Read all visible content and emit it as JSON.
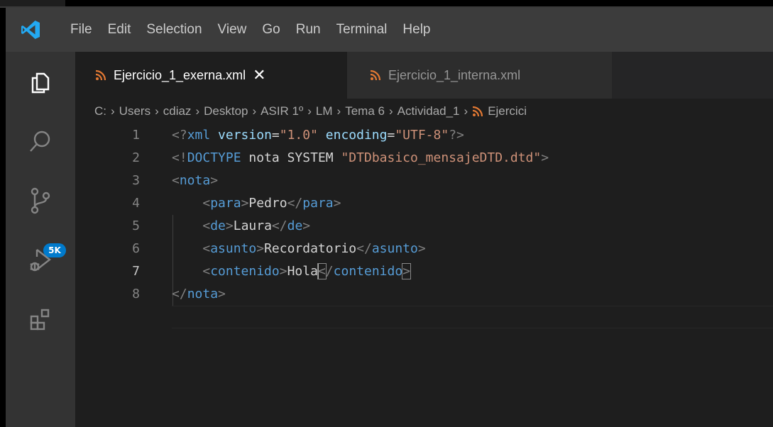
{
  "menu": {
    "items": [
      "File",
      "Edit",
      "Selection",
      "View",
      "Go",
      "Run",
      "Terminal",
      "Help"
    ]
  },
  "activity_bar": {
    "icons": [
      "files-icon",
      "search-icon",
      "source-control-icon",
      "run-debug-icon",
      "extensions-icon"
    ],
    "source_control_badge": "5K",
    "badge_color": "#007acc"
  },
  "tabs": [
    {
      "label": "Ejercicio_1_exerna.xml",
      "icon": "rss-icon",
      "active": true,
      "close_label": "✕"
    },
    {
      "label": "Ejercicio_1_interna.xml",
      "icon": "rss-icon",
      "active": false
    }
  ],
  "breadcrumb": {
    "parts": [
      "C:",
      "Users",
      "cdiaz",
      "Desktop",
      "ASIR 1º",
      "LM",
      "Tema 6",
      "Actividad_1",
      "Ejercici"
    ],
    "separator": "›"
  },
  "editor": {
    "current_line": 7,
    "lines": [
      {
        "n": "1",
        "text": "<?xml version=\"1.0\" encoding=\"UTF-8\"?>"
      },
      {
        "n": "2",
        "text": "<!DOCTYPE nota SYSTEM \"DTDbasico_mensajeDTD.dtd\">"
      },
      {
        "n": "3",
        "text": "<nota>"
      },
      {
        "n": "4",
        "text": "    <para>Pedro</para>"
      },
      {
        "n": "5",
        "text": "    <de>Laura</de>"
      },
      {
        "n": "6",
        "text": "    <asunto>Recordatorio</asunto>"
      },
      {
        "n": "7",
        "text": "    <contenido>Hola</contenido>"
      },
      {
        "n": "8",
        "text": "</nota>"
      }
    ]
  },
  "colors": {
    "accent": "#007acc",
    "rss_icon": "#e37933",
    "tag": "#569cd6",
    "attribute": "#9cdcfe",
    "string": "#ce9178",
    "text": "#d4d4d4"
  }
}
